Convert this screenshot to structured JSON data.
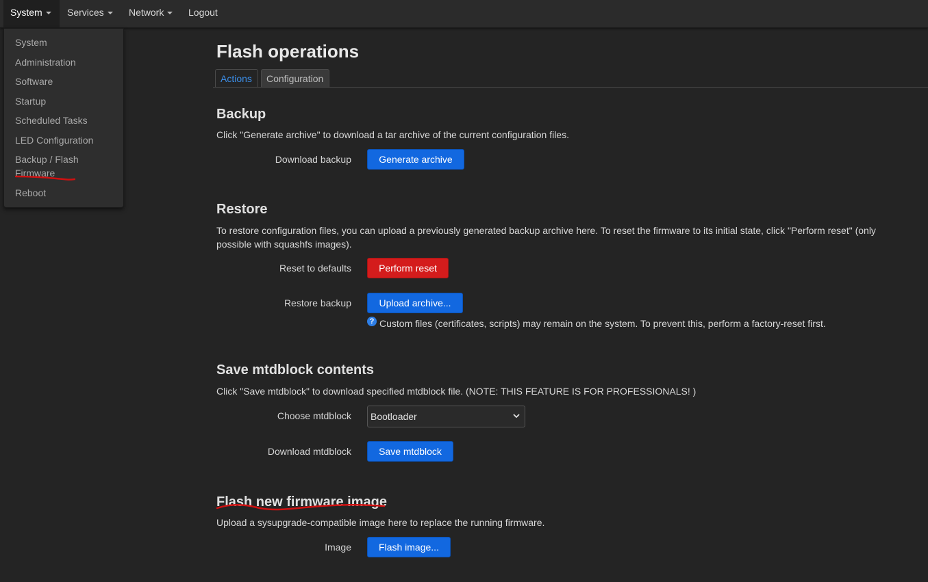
{
  "navbar": {
    "items": [
      {
        "label": "System",
        "has_caret": true,
        "active": true
      },
      {
        "label": "Services",
        "has_caret": true,
        "active": false
      },
      {
        "label": "Network",
        "has_caret": true,
        "active": false
      },
      {
        "label": "Logout",
        "has_caret": false,
        "active": false
      }
    ]
  },
  "dropdown": {
    "items": [
      {
        "label": "System"
      },
      {
        "label": "Administration"
      },
      {
        "label": "Software"
      },
      {
        "label": "Startup"
      },
      {
        "label": "Scheduled Tasks"
      },
      {
        "label": "LED Configuration"
      },
      {
        "label": "Backup / Flash Firmware"
      },
      {
        "label": "Reboot"
      }
    ]
  },
  "page": {
    "title": "Flash operations",
    "tabs": [
      {
        "label": "Actions",
        "active": true
      },
      {
        "label": "Configuration",
        "active": false
      }
    ]
  },
  "backup": {
    "heading": "Backup",
    "description": "Click \"Generate archive\" to download a tar archive of the current configuration files.",
    "download_label": "Download backup",
    "generate_button": "Generate archive"
  },
  "restore": {
    "heading": "Restore",
    "description": "To restore configuration files, you can upload a previously generated backup archive here. To reset the firmware to its initial state, click \"Perform reset\" (only possible with squashfs images).",
    "reset_label": "Reset to defaults",
    "reset_button": "Perform reset",
    "restore_label": "Restore backup",
    "upload_button": "Upload archive...",
    "help_text": "Custom files (certificates, scripts) may remain on the system. To prevent this, perform a factory-reset first."
  },
  "mtdblock": {
    "heading": "Save mtdblock contents",
    "description": "Click \"Save mtdblock\" to download specified mtdblock file. (NOTE: THIS FEATURE IS FOR PROFESSIONALS! )",
    "choose_label": "Choose mtdblock",
    "selected": "Bootloader",
    "download_label": "Download mtdblock",
    "save_button": "Save mtdblock"
  },
  "flash": {
    "heading": "Flash new firmware image",
    "description": "Upload a sysupgrade-compatible image here to replace the running firmware.",
    "image_label": "Image",
    "flash_button": "Flash image..."
  },
  "colors": {
    "background": "#242424",
    "primary_button": "#1268e0",
    "danger_button": "#d41c1c",
    "annotation_red": "#d01010",
    "active_tab": "#3b8ee8"
  }
}
